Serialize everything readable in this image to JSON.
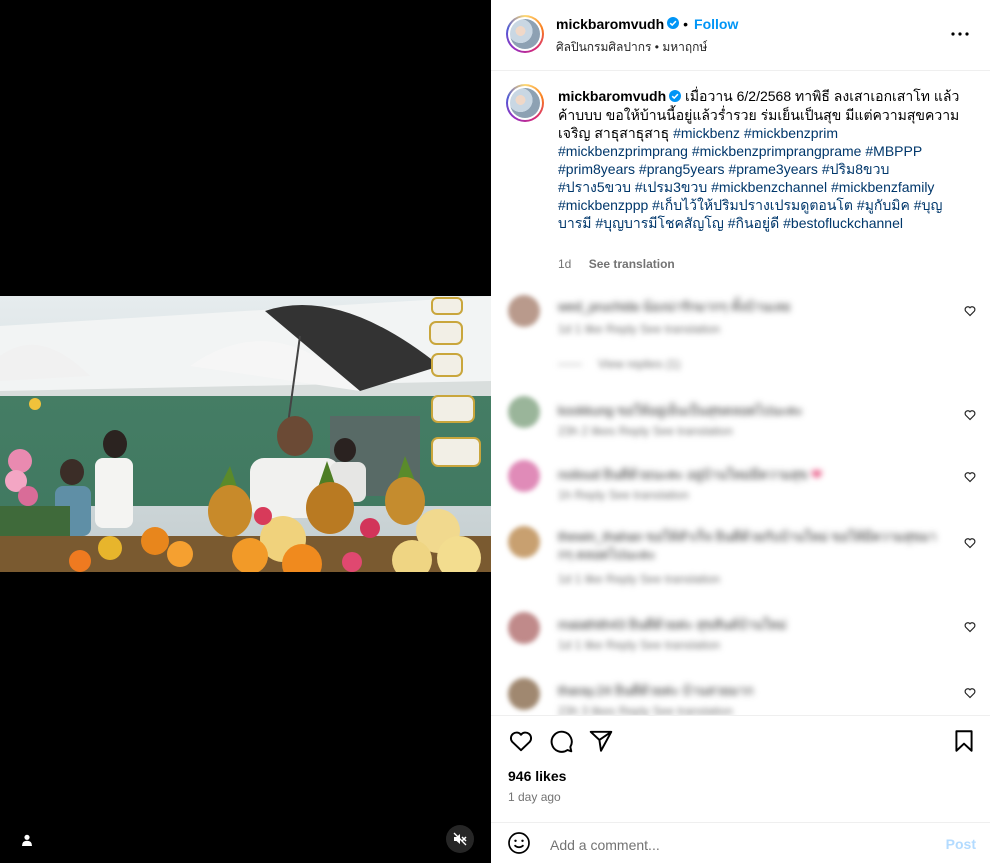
{
  "post": {
    "username": "mickbaromvudh",
    "follow_label": "Follow",
    "separator": "•",
    "location": "ศิลปินกรมศิลปากร • มหาฤกษ์",
    "caption_intro": "เมื่อวาน 6/2/2568 ทาพิธี ลงเสาเอกเสาโท แล้ว ค้าบบบ ขอให้บ้านนี้อยู่แล้วร่ำรวย ร่มเย็นเป็นสุข มีแต่ความสุขความเจริญ สาธุสาธุสาธุ",
    "hashtags": [
      "#mickbenz",
      "#mickbenzprim",
      "#mickbenzprimprang",
      "#mickbenzprimprangprame",
      "#MBPPP",
      "#prim8years",
      "#prang5years",
      "#prame3years",
      "#ปริม8ขวบ",
      "#ปราง5ขวบ",
      "#เปรม3ขวบ",
      "#mickbenzchannel",
      "#mickbenzfamily",
      "#mickbenzppp",
      "#เก็บไว้ให้ปริมปรางเปรมดูตอนโต",
      "#มูกับมิค",
      "#บุญบารมี",
      "#บุญบารมีโชคสัญโญ",
      "#กินอยู่ดี",
      "#bestofluckchannel"
    ],
    "caption_age": "1d",
    "see_translation": "See translation",
    "likes": "946 likes",
    "time_ago": "1 day ago"
  },
  "comments": [
    {
      "text": "wed_pruchida น้องน่ารักมากๆ ทั้งบ้านเลย",
      "meta": "1d  1 like  Reply  See translation",
      "replies": "View replies (1)",
      "avatar_color": "#b99a8c"
    },
    {
      "text": "kookkung ขอให้อยู่เย็นเป็นสุขตลอดไปนะคะ",
      "meta": "23h  2 likes  Reply  See translation",
      "avatar_color": "#9ab59a"
    },
    {
      "text": "noiloud ยินดีด้วยนะคะ อยู่บ้านใหม่มีความสุข",
      "meta": "1h  Reply  See translation",
      "avatar_color": "#e08bb8",
      "has_emoji": "❤"
    },
    {
      "text": "thewin_thahan ขอให้สำเร็จ ยินดีด้วยกับบ้านใหม่ ขอให้มีความสุขมากๆ ตลอดไปนะคะ",
      "meta": "1d  1 like  Reply  See translation",
      "avatar_color": "#c8a070"
    },
    {
      "text": "maiathith43 ยินดีด้วยค่ะ สุขสันต์บ้านใหม่",
      "meta": "1d  1 like  Reply  See translation",
      "avatar_color": "#c08a8a"
    },
    {
      "text": "tharay.24 ยินดีด้วยค่ะ บ้านสวยมาก",
      "meta": "23h  3 likes  Reply  See translation",
      "avatar_color": "#a08870"
    }
  ],
  "comment_box": {
    "placeholder": "Add a comment...",
    "post_label": "Post"
  },
  "colors": {
    "accent": "#0095f6",
    "hashtag": "#00376b",
    "muted": "#737373",
    "post_disabled": "#b3dbff"
  }
}
